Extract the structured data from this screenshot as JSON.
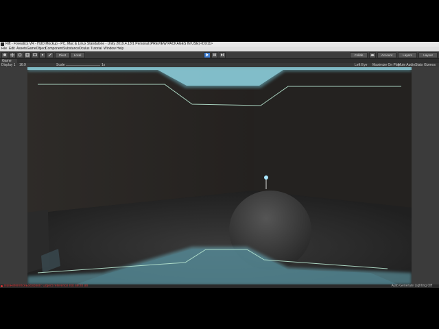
{
  "window": {
    "title": "Rift - Foveatics VR - HUD Mockup - PC, Mac & Linux Standalone - Unity 2019.4.13f1 Personal [PREVIEW PACKAGES IN USE] <DX11>"
  },
  "menu": [
    "File",
    "Edit",
    "Assets",
    "GameObject",
    "Component",
    "Substance",
    "Oculus",
    "Tutorial",
    "Window",
    "Help"
  ],
  "toolbar": {
    "pivot_label": "Pivot",
    "local_label": "Local",
    "collab_label": "Collab",
    "account_label": "Account",
    "layers_label": "Layers",
    "layout_label": "Layout"
  },
  "game_tab": {
    "tab_label": "Game",
    "display_label": "Display 1",
    "aspect_label": "16:9",
    "scale_label": "Scale",
    "scale_value": "1x",
    "eye_label": "Left Eye",
    "maximize_label": "Maximize On Play",
    "mute_label": "Mute Audio",
    "stats_label": "Stats",
    "gizmos_label": "Gizmos"
  },
  "status": {
    "error_text": "NullReferenceException: Object reference not set to an instance of an object",
    "lighting_text": "Auto Generate Lighting Off"
  },
  "colors": {
    "accent_glow": "#7fd6e8",
    "hud_line": "#b8e6d0",
    "error": "#d33333"
  }
}
